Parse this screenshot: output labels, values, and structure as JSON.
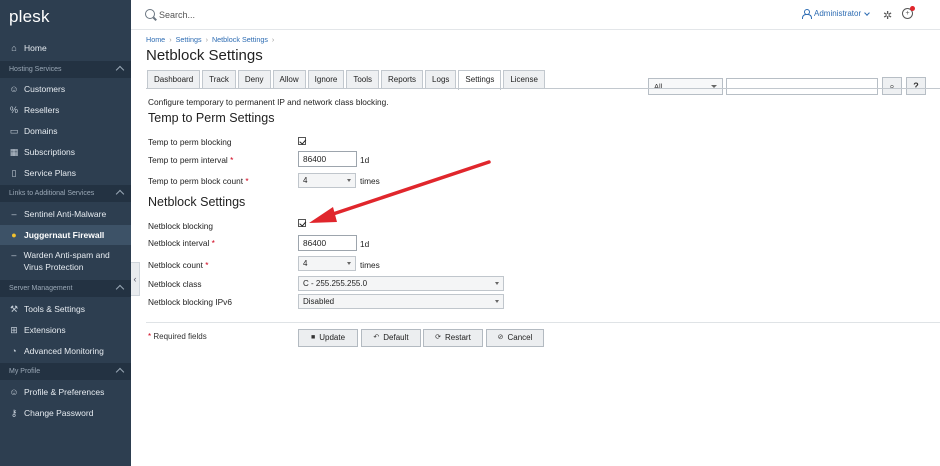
{
  "app": {
    "logo": "plesk"
  },
  "topbar": {
    "search_placeholder": "Search...",
    "user": "Administrator",
    "ext_icon": "puzzle-icon",
    "help_icon": "lifebuoy-icon"
  },
  "sidebar": {
    "home": "Home",
    "sections": {
      "hosting": "Hosting Services",
      "links": "Links to Additional Services",
      "server": "Server Management",
      "profile": "My Profile"
    },
    "hosting_items": [
      "Customers",
      "Resellers",
      "Domains",
      "Subscriptions",
      "Service Plans"
    ],
    "links_items": [
      "Sentinel Anti-Malware",
      "Juggernaut Firewall",
      "Warden Anti-spam and Virus Protection"
    ],
    "server_items": [
      "Tools & Settings",
      "Extensions",
      "Advanced Monitoring"
    ],
    "profile_items": [
      "Profile & Preferences",
      "Change Password"
    ]
  },
  "breadcrumb": [
    "Home",
    "Settings",
    "Netblock Settings"
  ],
  "page_title": "Netblock Settings",
  "filter": {
    "select_value": "All",
    "input_value": "",
    "search_button": "⌕",
    "help_button": "?"
  },
  "tabs": [
    "Dashboard",
    "Track",
    "Deny",
    "Allow",
    "Ignore",
    "Tools",
    "Reports",
    "Logs",
    "Settings",
    "License"
  ],
  "active_tab": "Settings",
  "intro": "Configure temporary to permanent IP and network class blocking.",
  "temp_section": {
    "heading": "Temp to Perm Settings",
    "blocking_label": "Temp to perm blocking",
    "blocking_checked": true,
    "interval_label": "Temp to perm interval",
    "interval_value": "86400",
    "interval_unit": "1d",
    "count_label": "Temp to perm block count",
    "count_value": "4",
    "count_unit": "times"
  },
  "netblock_section": {
    "heading": "Netblock Settings",
    "blocking_label": "Netblock blocking",
    "blocking_checked": true,
    "interval_label": "Netblock interval",
    "interval_value": "86400",
    "interval_unit": "1d",
    "count_label": "Netblock count",
    "count_value": "4",
    "count_unit": "times",
    "class_label": "Netblock class",
    "class_value": "C - 255.255.255.0",
    "ipv6_label": "Netblock blocking IPv6",
    "ipv6_value": "Disabled"
  },
  "required_star": "*",
  "required_note": "Required fields",
  "buttons": {
    "update": "Update",
    "default": "Default",
    "restart": "Restart",
    "cancel": "Cancel"
  },
  "colors": {
    "sidebar_bg": "#2d3e50",
    "accent_link": "#2d6cb3",
    "annotation_arrow": "#e0262c"
  }
}
